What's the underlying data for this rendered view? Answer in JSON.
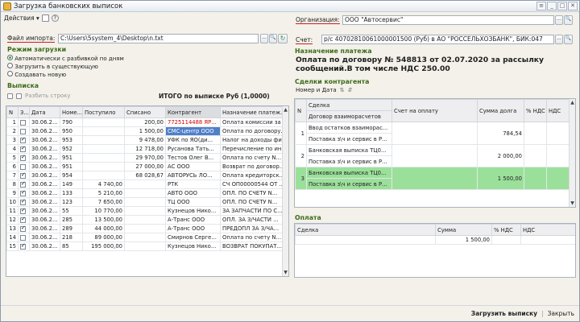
{
  "window": {
    "title": "Загрузка банковских выписок"
  },
  "toolbar": {
    "actions_label": "Действия ▾"
  },
  "left": {
    "import_label": "Файл импорта:",
    "import_path": "C:\\Users\\5system_4\\Desktop\\n.txt",
    "mode_title": "Режим загрузки",
    "modes": [
      "Автоматически с разбивкой по дням",
      "Загрузить в существующую",
      "Создавать новую"
    ],
    "statement_title": "Выписка",
    "split_label": "Разбить строку",
    "total_label": "ИТОГО по выписке Руб (1,0000)",
    "columns": [
      "N",
      "З...",
      "Дата",
      "Номе...",
      "Поступило",
      "Списано",
      "Контрагент",
      "Назначение платеж..."
    ],
    "rows": [
      {
        "n": "1",
        "chk": false,
        "date": "30.06.2...",
        "num": "790",
        "in": "",
        "out": "200,00",
        "cp": "7725114488 ЯР...",
        "purpose": "Оплата комиссии за ..."
      },
      {
        "n": "2",
        "chk": false,
        "date": "30.06.2...",
        "num": "950",
        "in": "",
        "out": "1 500,00",
        "cp": "СМС-центр ООО",
        "purpose": "Оплата по договору..."
      },
      {
        "n": "3",
        "chk": true,
        "date": "30.06.2...",
        "num": "953",
        "in": "",
        "out": "9 478,00",
        "cp": "УФК по ЯО(ди...",
        "purpose": "Налог на доходы фи..."
      },
      {
        "n": "4",
        "chk": true,
        "date": "30.06.2...",
        "num": "952",
        "in": "",
        "out": "12 718,00",
        "cp": "Русанова Тать...",
        "purpose": "Перечисление по ин..."
      },
      {
        "n": "5",
        "chk": true,
        "date": "30.06.2...",
        "num": "951",
        "in": "",
        "out": "29 970,00",
        "cp": "Тестов Олег В...",
        "purpose": "Оплата по счету N..."
      },
      {
        "n": "6",
        "chk": false,
        "date": "30.06.2...",
        "num": "951",
        "in": "",
        "out": "27 000,00",
        "cp": "АС ООО",
        "purpose": "Возврат по договор..."
      },
      {
        "n": "7",
        "chk": true,
        "date": "30.06.2...",
        "num": "954",
        "in": "",
        "out": "68 028,67",
        "cp": "АВТОРУСЬ ЛО...",
        "purpose": "Оплата кредиторск..."
      },
      {
        "n": "8",
        "chk": true,
        "date": "30.06.2...",
        "num": "149",
        "in": "4 740,00",
        "out": "",
        "cp": "РТК",
        "purpose": "СЧ ОП00000544 ОТ ..."
      },
      {
        "n": "9",
        "chk": true,
        "date": "30.06.2...",
        "num": "133",
        "in": "5 210,00",
        "out": "",
        "cp": "АВТО ООО",
        "purpose": "ОПЛ. ПО СЧЕТУ N..."
      },
      {
        "n": "10",
        "chk": true,
        "date": "30.06.2...",
        "num": "123",
        "in": "7 650,00",
        "out": "",
        "cp": "ТЦ ООО",
        "purpose": "ОПЛ. ПО СЧЕТУ N..."
      },
      {
        "n": "11",
        "chk": true,
        "date": "30.06.2...",
        "num": "55",
        "in": "10 770,00",
        "out": "",
        "cp": "Кузнецов Нико...",
        "purpose": "ЗА ЗАПЧАСТИ ПО С..."
      },
      {
        "n": "12",
        "chk": true,
        "date": "30.06.2...",
        "num": "285",
        "in": "13 500,00",
        "out": "",
        "cp": "А-Транс ООО",
        "purpose": "ОПЛ. ЗА З/ЧАСТИ ..."
      },
      {
        "n": "13",
        "chk": true,
        "date": "30.06.2...",
        "num": "289",
        "in": "44 000,00",
        "out": "",
        "cp": "А-Транс ООО",
        "purpose": "ПРЕДОПЛ ЗА З/ЧА..."
      },
      {
        "n": "14",
        "chk": false,
        "date": "30.06.2...",
        "num": "218",
        "in": "89 000,00",
        "out": "",
        "cp": "Смирнов Серге...",
        "purpose": "Оплата по счету N..."
      },
      {
        "n": "15",
        "chk": true,
        "date": "30.06.2...",
        "num": "85",
        "in": "195 000,00",
        "out": "",
        "cp": "Кузнецов Нико...",
        "purpose": "ВОЗВРАТ ПОКУПАТ..."
      }
    ]
  },
  "right": {
    "org_label": "Организация:",
    "org_value": "ООО \"Автосервис\"",
    "account_label": "Счет:",
    "account_value": "р/с 40702810061000001500 (Руб) в АО \"РОССЕЛЬХОЗБАНК\", БИК:047",
    "purpose_title": "Назначение платежа",
    "purpose_text": "Оплата по договору № 548813 от 02.07.2020 за рассылку сообщений.В том числе НДС 250.00",
    "deals_title": "Сделки контрагента",
    "sort_label": "Номер и Дата",
    "deal_columns": [
      "N",
      "Сделка",
      "Счет на оплату",
      "Сумма долга",
      "% НДС",
      "НДС"
    ],
    "deal_sub_column": "Договор взаиморасчетов",
    "deals": [
      {
        "n": "1",
        "deal": "Ввод остатков взаиморас...",
        "contract": "Поставка з\\ч и сервис в Р...",
        "amount": "784,54"
      },
      {
        "n": "2",
        "deal": "Банковская выписка ТЦ0...",
        "contract": "Поставка з\\ч и сервис в Р...",
        "amount": "2 000,00"
      },
      {
        "n": "3",
        "deal": "Банковская выписка ТЦ0...",
        "contract": "Поставка з\\ч и сервис в Р...",
        "amount": "1 500,00"
      }
    ],
    "payment_title": "Оплата",
    "payment_columns": [
      "Сделка",
      "Сумма",
      "% НДС",
      "НДС"
    ],
    "payment_amount": "1 500,00"
  },
  "footer": {
    "load_label": "Загрузить выписку",
    "close_label": "Закрыть"
  },
  "colors": {
    "highlight": "#9be09a",
    "selection": "#4f7fc8",
    "section": "#3d6a1a"
  }
}
